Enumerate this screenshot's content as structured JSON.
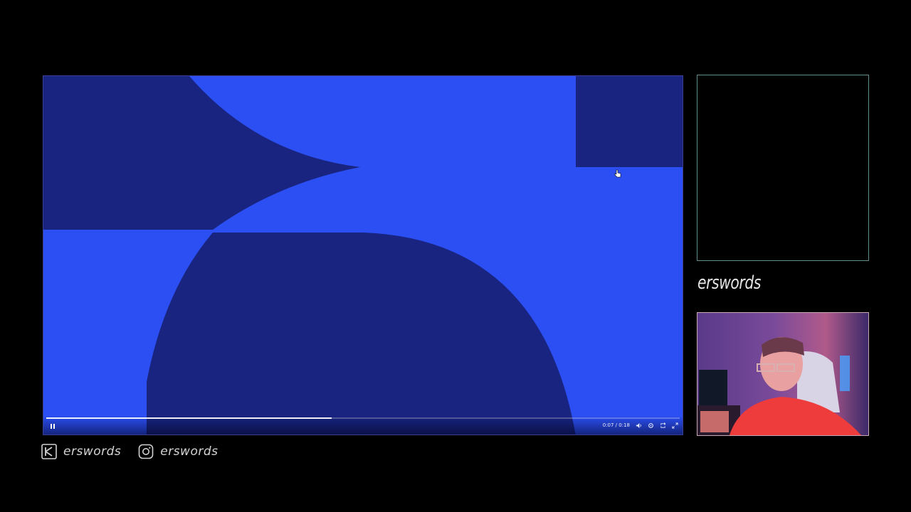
{
  "player": {
    "time_current": "0:07",
    "time_separator": "/",
    "time_total": "0:18",
    "progress": 0.45,
    "buffered": 0.45,
    "icons": {
      "play_state": "pause-icon",
      "volume": "volume-icon",
      "settings": "settings-icon",
      "loop": "loop-icon",
      "fullscreen": "fullscreen-icon"
    },
    "colors": {
      "bright_blue": "#2b4ff2",
      "dark_blue": "#18247f"
    }
  },
  "sidebar": {
    "channel_name": "erswords"
  },
  "footer": {
    "socials": [
      {
        "icon": "kick-icon",
        "handle": "erswords"
      },
      {
        "icon": "instagram-icon",
        "handle": "erswords"
      }
    ]
  }
}
